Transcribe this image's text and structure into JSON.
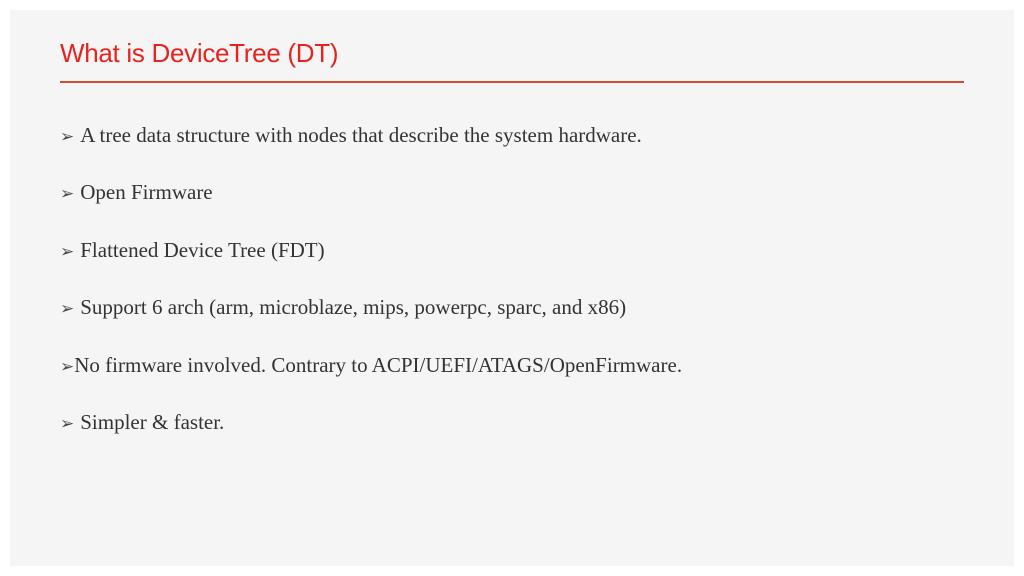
{
  "title": "What is DeviceTree (DT)",
  "bullets": [
    {
      "text": "A tree data structure with nodes that describe the system hardware.",
      "tight": false
    },
    {
      "text": "Open Firmware",
      "tight": false
    },
    {
      "text": "Flattened Device Tree (FDT)",
      "tight": false
    },
    {
      "text": "Support 6 arch (arm, microblaze, mips, powerpc, sparc, and x86)",
      "tight": false
    },
    {
      "text": "No firmware involved. Contrary to ACPI/UEFI/ATAGS/OpenFirmware.",
      "tight": true
    },
    {
      "text": "Simpler & faster.",
      "tight": false
    }
  ],
  "colors": {
    "accent": "#e6241f",
    "divider": "#d84b2f",
    "bullet_arrow": "#4a4a4a",
    "body_text": "#333333",
    "slide_bg": "#f5f5f5"
  }
}
